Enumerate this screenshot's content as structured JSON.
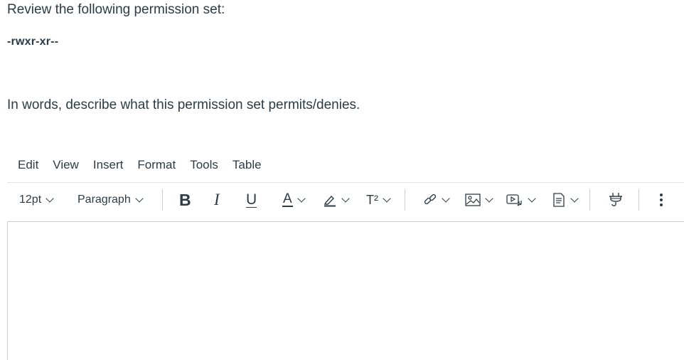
{
  "question": {
    "prompt": "Review the following permission set:",
    "permission": "-rwxr-xr--",
    "instruction": "In words, describe what this permission set permits/denies."
  },
  "menubar": {
    "items": [
      "Edit",
      "View",
      "Insert",
      "Format",
      "Tools",
      "Table"
    ]
  },
  "toolbar": {
    "font_size": "12pt",
    "block_format": "Paragraph",
    "bold_label": "B",
    "italic_label": "I",
    "underline_label": "U",
    "text_color_label": "A",
    "superscript_label": "T²",
    "icons": [
      "bold-icon",
      "italic-icon",
      "underline-icon",
      "text-color-icon",
      "highlight-icon",
      "superscript-icon",
      "link-icon",
      "image-icon",
      "media-icon",
      "document-icon",
      "apps-plug-icon",
      "more-icon"
    ],
    "accent_color": "#2d3b45"
  },
  "editor": {
    "content": ""
  }
}
